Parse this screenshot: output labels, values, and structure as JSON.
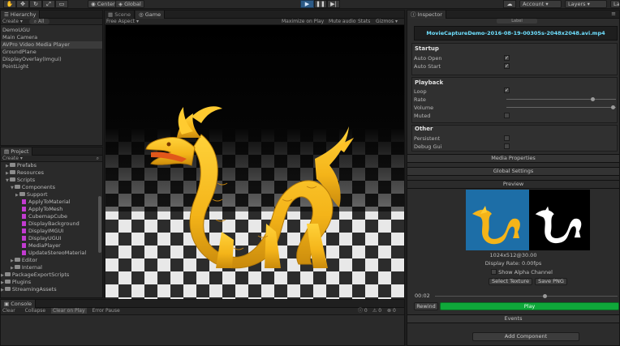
{
  "toolbar": {
    "pivot_label": "Center",
    "space_label": "Global",
    "account_label": "Account",
    "layers_label": "Layers",
    "layout_label": "La"
  },
  "hierarchy": {
    "tab_label": "Hierarchy",
    "create_label": "Create",
    "search_placeholder": "All",
    "items": [
      "DemoUGU",
      "Main Camera",
      "AVPro Video Media Player",
      "GroundPlane",
      "DisplayOverlay(Imgui)",
      "PointLight"
    ]
  },
  "project": {
    "tab_label": "Project",
    "create_label": "Create",
    "items": [
      "Prefabs",
      "Resources",
      "Scripts",
      "Components",
      "Support",
      "ApplyToMaterial",
      "ApplyToMesh",
      "CubemapCube",
      "DisplayBackground",
      "DisplayIMGUI",
      "DisplayUGUI",
      "MediaPlayer",
      "UpdateStereoMaterial",
      "Editor",
      "Internal",
      "PackageExportScripts",
      "Plugins",
      "StreamingAssets"
    ]
  },
  "scene_tab": "Scene",
  "game": {
    "tab_label": "Game",
    "aspect_label": "Free Aspect",
    "maximize_label": "Maximize on Play",
    "mute_label": "Mute audio",
    "stats_label": "Stats",
    "gizmos_label": "Gizmos"
  },
  "console": {
    "tab_label": "Console",
    "clear_label": "Clear",
    "collapse_label": "Collapse",
    "clear_on_play_label": "Clear on Play",
    "error_pause_label": "Error Pause",
    "count_a": "0",
    "count_b": "0",
    "count_c": "0"
  },
  "inspector": {
    "tab_label": "Inspector",
    "header_partial": "Label",
    "file_name": "MovieCaptureDemo-2016-08-19-00305s-2048x2048.avi.mp4",
    "startup": {
      "title": "Startup",
      "auto_open": "Auto Open",
      "auto_start": "Auto Start"
    },
    "playback": {
      "title": "Playback",
      "loop": "Loop",
      "rate": "Rate",
      "volume": "Volume",
      "muted": "Muted",
      "rate_fraction": 0.79,
      "volume_fraction": 0.99
    },
    "other": {
      "title": "Other",
      "persistent": "Persistent",
      "debug_gui": "Debug Gui"
    },
    "media_properties": "Media Properties",
    "global_settings": "Global Settings",
    "preview_label": "Preview",
    "resolution": "1024x512@30.00",
    "display_rate": "Display Rate: 0.00fps",
    "show_alpha": "Show Alpha Channel",
    "select_texture": "Select Texture",
    "save_png": "Save PNG",
    "time": "00:02",
    "rewind_label": "Rewind",
    "play_label": "Play",
    "events_label": "Events",
    "add_component": "Add Component"
  },
  "colors": {
    "accent_green": "#0fa83a",
    "preview_blue": "#1d6ea7",
    "filename_cyan": "#6fe0ff",
    "dragon_gold": "#f4b419"
  }
}
